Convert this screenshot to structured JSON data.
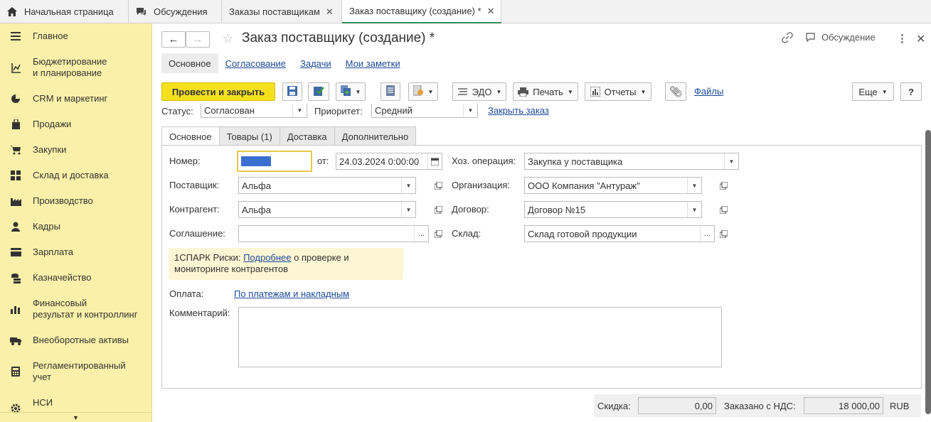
{
  "top_tabs": [
    {
      "label": "Начальная страница",
      "icon": "home-icon"
    },
    {
      "label": "Обсуждения",
      "icon": "chat-icon"
    },
    {
      "label": "Заказы поставщикам",
      "close": "✕"
    },
    {
      "label": "Заказ поставщику (создание) *",
      "close": "✕"
    }
  ],
  "sidebar": {
    "items": [
      {
        "label": "Главное",
        "icon": "menu-icon"
      },
      {
        "label": "Бюджетирование\nи планирование",
        "icon": "budget-icon"
      },
      {
        "label": "CRM и маркетинг",
        "icon": "pie-icon"
      },
      {
        "label": "Продажи",
        "icon": "bag-icon"
      },
      {
        "label": "Закупки",
        "icon": "cart-icon"
      },
      {
        "label": "Склад и доставка",
        "icon": "grid-icon"
      },
      {
        "label": "Производство",
        "icon": "factory-icon"
      },
      {
        "label": "Кадры",
        "icon": "person-icon"
      },
      {
        "label": "Зарплата",
        "icon": "wallet-icon"
      },
      {
        "label": "Казначейство",
        "icon": "coins-icon"
      },
      {
        "label": "Финансовый\nрезультат и контроллинг",
        "icon": "bar-chart-icon"
      },
      {
        "label": "Внеоборотные активы",
        "icon": "truck-icon"
      },
      {
        "label": "Регламентированный\nучет",
        "icon": "calculator-icon"
      },
      {
        "label": "НСИ",
        "icon": "gear-icon"
      }
    ]
  },
  "header": {
    "title": "Заказ поставщику (создание) *",
    "discussion_label": "Обсуждение"
  },
  "subtabs": [
    "Основное",
    "Согласование",
    "Задачи",
    "Мои заметки"
  ],
  "toolbar": {
    "post_close": "Провести и закрыть",
    "edo": "ЭДО",
    "print": "Печать",
    "reports": "Отчеты",
    "files": "Файлы",
    "more": "Еще",
    "help": "?"
  },
  "statusline": {
    "status_label": "Статус:",
    "status_value": "Согласован",
    "priority_label": "Приоритет:",
    "priority_value": "Средний",
    "close_order": "Закрыть заказ"
  },
  "form_tabs": [
    "Основное",
    "Товары (1)",
    "Доставка",
    "Дополнительно"
  ],
  "form": {
    "number_label": "Номер:",
    "from_label": "от:",
    "date_value": "24.03.2024  0:00:00",
    "operation_label": "Хоз. операция:",
    "operation_value": "Закупка у поставщика",
    "supplier_label": "Поставщик:",
    "supplier_value": "Альфа",
    "org_label": "Организация:",
    "org_value": "ООО Компания \"Антураж\"",
    "counterparty_label": "Контрагент:",
    "counterparty_value": "Альфа",
    "contract_label": "Договор:",
    "contract_value": "Договор №15",
    "agreement_label": "Соглашение:",
    "agreement_value": "",
    "warehouse_label": "Склад:",
    "warehouse_value": "Склад готовой продукции",
    "spark_prefix": "1СПАРК Риски: ",
    "spark_link": "Подробнее",
    "spark_suffix": " о проверке и",
    "spark_line2": "мониторинге контрагентов",
    "payment_label": "Оплата:",
    "payment_link": "По платежам и накладным",
    "comment_label": "Комментарий:",
    "comment_value": ""
  },
  "footer": {
    "discount_label": "Скидка:",
    "discount_value": "0,00",
    "ordered_label": "Заказано с НДС:",
    "ordered_value": "18 000,00",
    "currency": "RUB"
  },
  "colors": {
    "accent": "#f5e01d",
    "sidebar": "#fbf0a9",
    "link": "#1c4a9a",
    "active_tab": "#2e8b57"
  }
}
